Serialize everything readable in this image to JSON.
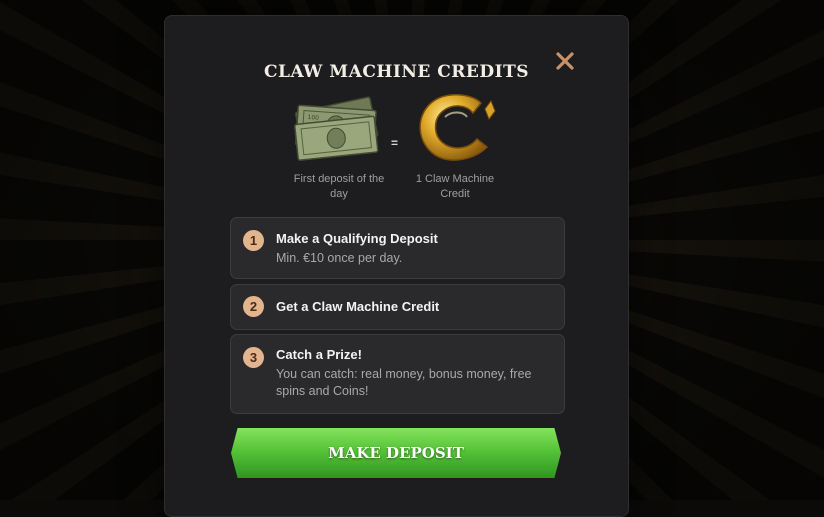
{
  "modal": {
    "title": "CLAW MACHINE CREDITS",
    "close_icon": "close-icon",
    "equals": "=",
    "left_caption": "First deposit of the day",
    "right_caption": "1 Claw Machine Credit",
    "steps": [
      {
        "number": "1",
        "title": "Make a Qualifying Deposit",
        "description": "Min. €10 once per day."
      },
      {
        "number": "2",
        "title": "Get a Claw Machine Credit",
        "description": ""
      },
      {
        "number": "3",
        "title": "Catch a Prize!",
        "description": "You can catch: real money, bonus money, free spins and Coins!"
      }
    ],
    "deposit_button": "MAKE DEPOSIT"
  },
  "colors": {
    "modal_bg": "#1d1d1f",
    "step_bg": "#2a2a2d",
    "number_badge": "#e3b58f",
    "close_icon": "#c9916a",
    "button_green": "#56c338"
  }
}
